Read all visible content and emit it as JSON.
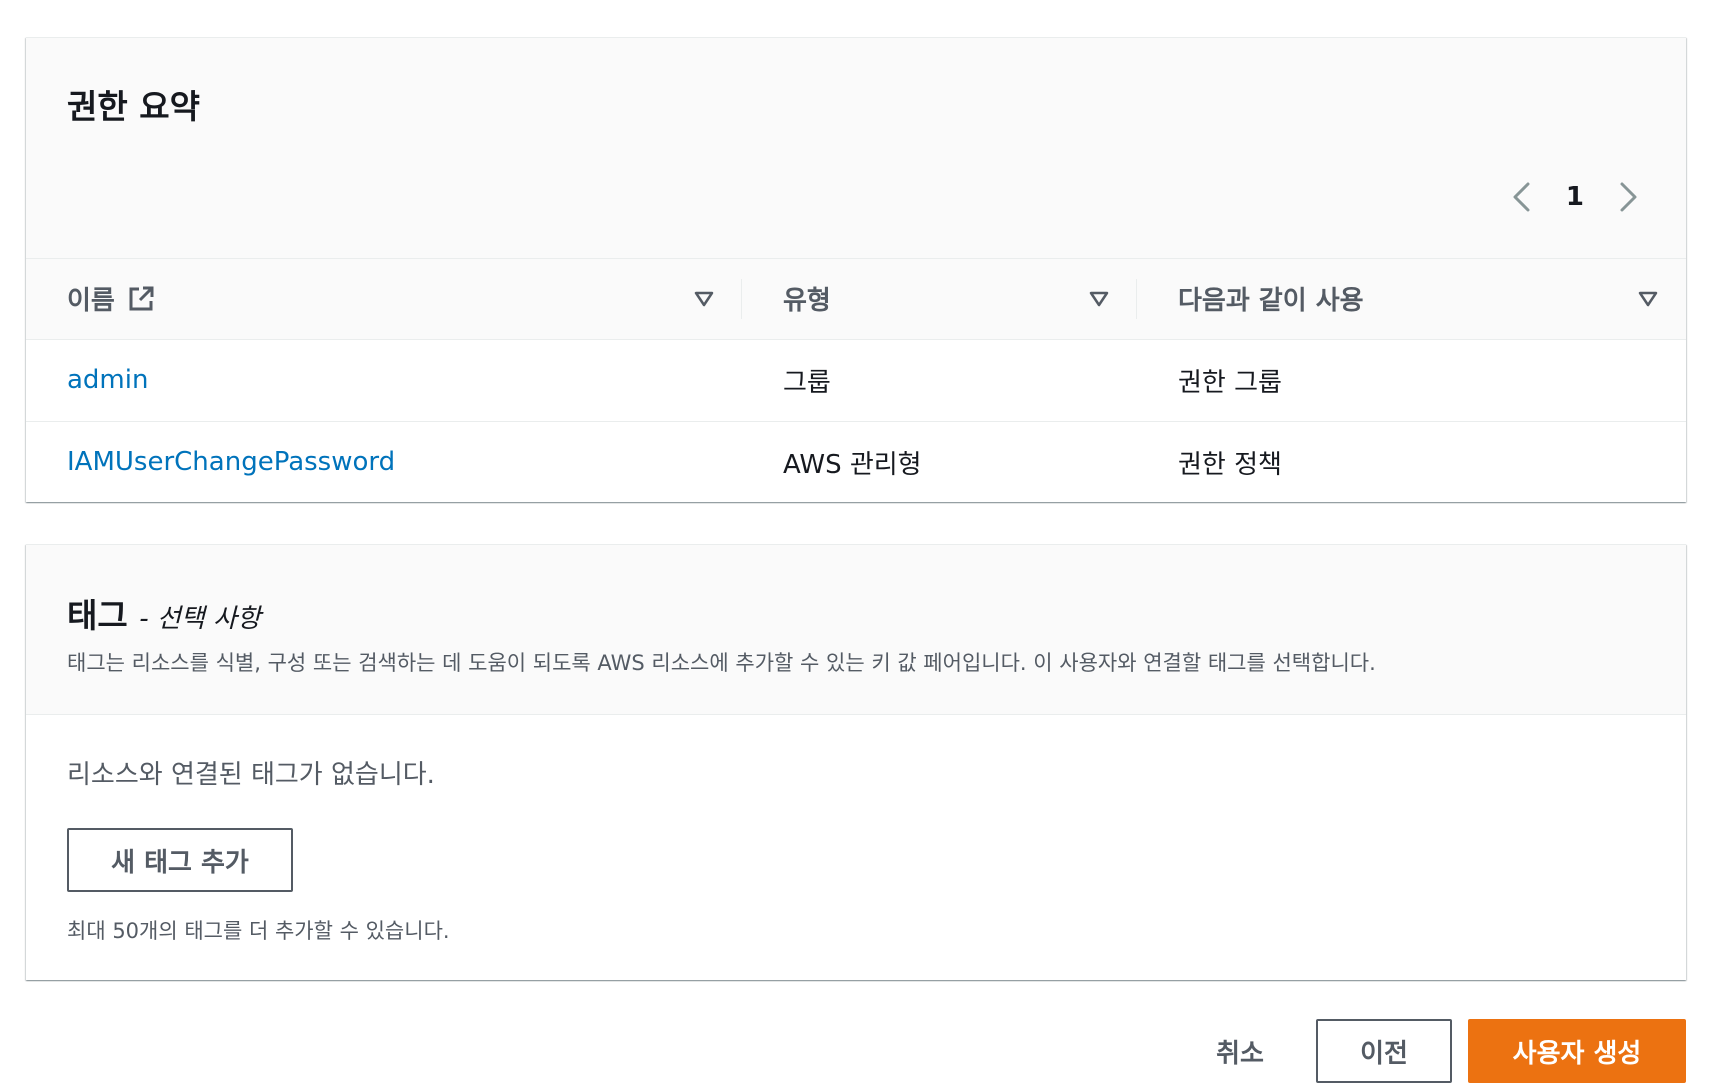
{
  "permissions": {
    "title": "권한 요약",
    "pagination": {
      "current_page": "1"
    },
    "columns": [
      "이름",
      "유형",
      "다음과 같이 사용"
    ],
    "rows": [
      {
        "name": "admin",
        "type": "그룹",
        "used_as": "권한 그룹"
      },
      {
        "name": "IAMUserChangePassword",
        "type": "AWS 관리형",
        "used_as": "권한 정책"
      }
    ]
  },
  "tags": {
    "title": "태그",
    "title_optional": "- 선택 사항",
    "description": "태그는 리소스를 식별, 구성 또는 검색하는 데 도움이 되도록 AWS 리소스에 추가할 수 있는 키 값 페어입니다. 이 사용자와 연결할 태그를 선택합니다.",
    "empty_message": "리소스와 연결된 태그가 없습니다.",
    "add_button": "새 태그 추가",
    "hint": "최대 50개의 태그를 더 추가할 수 있습니다."
  },
  "footer": {
    "cancel": "취소",
    "previous": "이전",
    "create": "사용자 생성"
  },
  "colors": {
    "link": "#0073bb",
    "primary": "#ec7211",
    "secondary_text": "#545b64"
  },
  "icons": [
    "chevron-left-icon",
    "chevron-right-icon",
    "external-link-icon",
    "sort-caret-icon"
  ]
}
